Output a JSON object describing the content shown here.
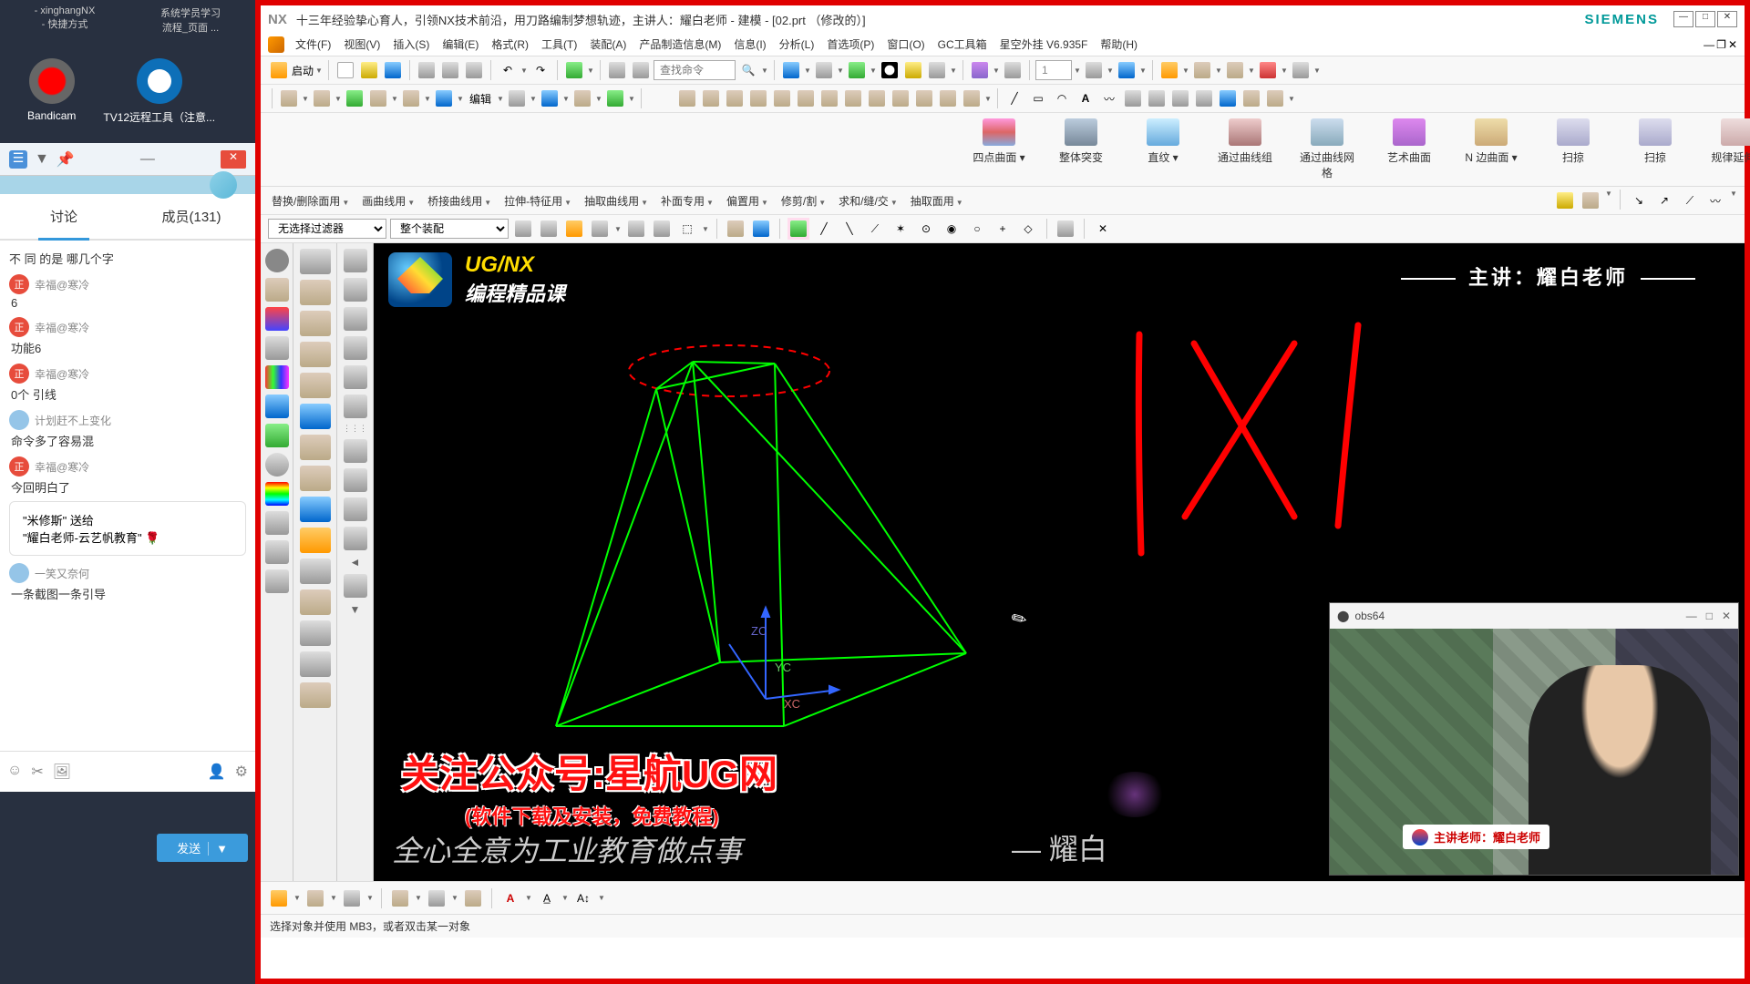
{
  "left": {
    "taskbar": [
      "- xinghangNX",
      "系统学员学习"
    ],
    "taskbar2": [
      "- 快捷方式",
      "流程_页面 ..."
    ],
    "icons": [
      {
        "label": "Bandicam"
      },
      {
        "label": "TV12远程工具（注意..."
      }
    ],
    "tabs": {
      "discuss": "讨论",
      "members": "成员(131)"
    },
    "messages": [
      {
        "type": "text",
        "text": "不 同 的是 哪几个字"
      },
      {
        "type": "user",
        "avatar": "正",
        "cls": "av-red",
        "name": "幸福@寒冷"
      },
      {
        "type": "text",
        "text": "6"
      },
      {
        "type": "user",
        "avatar": "正",
        "cls": "av-red",
        "name": "幸福@寒冷"
      },
      {
        "type": "text",
        "text": "功能6"
      },
      {
        "type": "user",
        "avatar": "正",
        "cls": "av-red",
        "name": "幸福@寒冷"
      },
      {
        "type": "text",
        "text": "0个 引线"
      },
      {
        "type": "user",
        "avatar": "",
        "cls": "av-blue",
        "name": "计划赶不上变化"
      },
      {
        "type": "text",
        "text": "命令多了容易混"
      },
      {
        "type": "user",
        "avatar": "正",
        "cls": "av-red",
        "name": "幸福@寒冷"
      },
      {
        "type": "text",
        "text": "今回明白了"
      }
    ],
    "gift": {
      "line1": "\"米修斯\" 送给",
      "line2": "\"耀白老师-云艺帆教育\" 🌹"
    },
    "lastuser": {
      "avatar": "",
      "cls": "av-blue",
      "name": "一笑又奈何",
      "text": "一条截图一条引导"
    },
    "send": "发送"
  },
  "nx": {
    "title": "十三年经验挚心育人，引领NX技术前沿，用刀路编制梦想轨迹，主讲人：耀白老师 - 建模 - [02.prt （修改的）]",
    "logo": "NX",
    "brand": "SIEMENS",
    "menu": [
      "文件(F)",
      "视图(V)",
      "插入(S)",
      "编辑(E)",
      "格式(R)",
      "工具(T)",
      "装配(A)",
      "产品制造信息(M)",
      "信息(I)",
      "分析(L)",
      "首选项(P)",
      "窗口(O)",
      "GC工具箱",
      "星空外挂 V6.935F",
      "帮助(H)"
    ],
    "start": "启动",
    "search_ph": "查找命令",
    "layer_val": "1",
    "ribbon": [
      "四点曲面",
      "整体突变",
      "直纹",
      "通过曲线组",
      "通过曲线网格",
      "艺术曲面",
      "N 边曲面",
      "扫掠",
      "扫掠",
      "规律延伸"
    ],
    "subtool": [
      "替换/删除面用",
      "画曲线用",
      "桥接曲线用",
      "拉伸-特征用",
      "抽取曲线用",
      "补面专用",
      "偏置用",
      "修剪/割",
      "求和/缝/交",
      "抽取面用"
    ],
    "filter1": "无选择过滤器",
    "filter2": "整个装配",
    "status": "选择对象并使用 MB3，或者双击某一对象"
  },
  "viewport": {
    "title1": "UG/NX",
    "title2": "编程精品课",
    "lecturer": "主讲：耀白老师",
    "overlay_red": "关注公众号:星航UG网",
    "overlay_red2": "(软件下载及安装，免费教程)",
    "overlay_white": "全心全意为工业教育做点事",
    "author": "— 耀白",
    "axis_x": "XC",
    "axis_y": "YC",
    "axis_z": "ZC"
  },
  "webcam": {
    "title": "obs64",
    "label": "主讲老师：耀白老师"
  }
}
